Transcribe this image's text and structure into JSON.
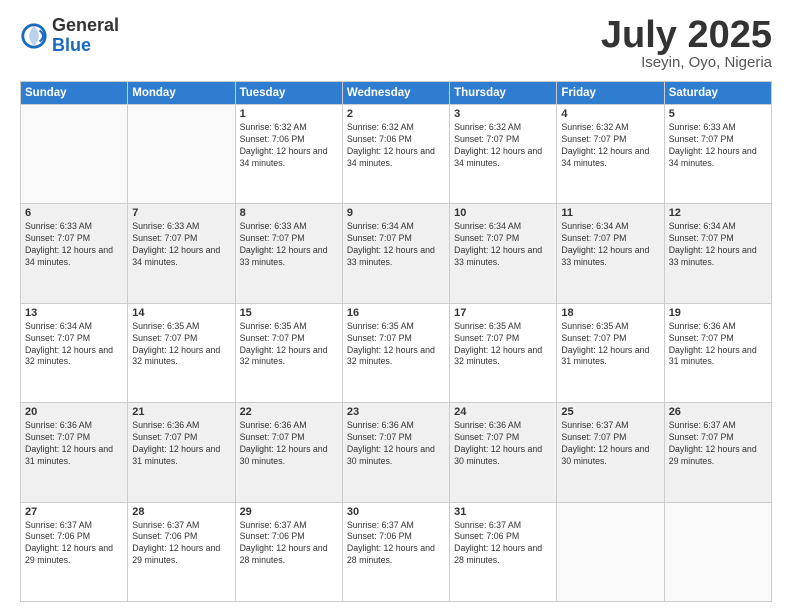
{
  "logo": {
    "general": "General",
    "blue": "Blue"
  },
  "title": "July 2025",
  "location": "Iseyin, Oyo, Nigeria",
  "days_of_week": [
    "Sunday",
    "Monday",
    "Tuesday",
    "Wednesday",
    "Thursday",
    "Friday",
    "Saturday"
  ],
  "weeks": [
    [
      {
        "day": "",
        "info": ""
      },
      {
        "day": "",
        "info": ""
      },
      {
        "day": "1",
        "sunrise": "Sunrise: 6:32 AM",
        "sunset": "Sunset: 7:06 PM",
        "daylight": "Daylight: 12 hours and 34 minutes."
      },
      {
        "day": "2",
        "sunrise": "Sunrise: 6:32 AM",
        "sunset": "Sunset: 7:06 PM",
        "daylight": "Daylight: 12 hours and 34 minutes."
      },
      {
        "day": "3",
        "sunrise": "Sunrise: 6:32 AM",
        "sunset": "Sunset: 7:07 PM",
        "daylight": "Daylight: 12 hours and 34 minutes."
      },
      {
        "day": "4",
        "sunrise": "Sunrise: 6:32 AM",
        "sunset": "Sunset: 7:07 PM",
        "daylight": "Daylight: 12 hours and 34 minutes."
      },
      {
        "day": "5",
        "sunrise": "Sunrise: 6:33 AM",
        "sunset": "Sunset: 7:07 PM",
        "daylight": "Daylight: 12 hours and 34 minutes."
      }
    ],
    [
      {
        "day": "6",
        "sunrise": "Sunrise: 6:33 AM",
        "sunset": "Sunset: 7:07 PM",
        "daylight": "Daylight: 12 hours and 34 minutes."
      },
      {
        "day": "7",
        "sunrise": "Sunrise: 6:33 AM",
        "sunset": "Sunset: 7:07 PM",
        "daylight": "Daylight: 12 hours and 34 minutes."
      },
      {
        "day": "8",
        "sunrise": "Sunrise: 6:33 AM",
        "sunset": "Sunset: 7:07 PM",
        "daylight": "Daylight: 12 hours and 33 minutes."
      },
      {
        "day": "9",
        "sunrise": "Sunrise: 6:34 AM",
        "sunset": "Sunset: 7:07 PM",
        "daylight": "Daylight: 12 hours and 33 minutes."
      },
      {
        "day": "10",
        "sunrise": "Sunrise: 6:34 AM",
        "sunset": "Sunset: 7:07 PM",
        "daylight": "Daylight: 12 hours and 33 minutes."
      },
      {
        "day": "11",
        "sunrise": "Sunrise: 6:34 AM",
        "sunset": "Sunset: 7:07 PM",
        "daylight": "Daylight: 12 hours and 33 minutes."
      },
      {
        "day": "12",
        "sunrise": "Sunrise: 6:34 AM",
        "sunset": "Sunset: 7:07 PM",
        "daylight": "Daylight: 12 hours and 33 minutes."
      }
    ],
    [
      {
        "day": "13",
        "sunrise": "Sunrise: 6:34 AM",
        "sunset": "Sunset: 7:07 PM",
        "daylight": "Daylight: 12 hours and 32 minutes."
      },
      {
        "day": "14",
        "sunrise": "Sunrise: 6:35 AM",
        "sunset": "Sunset: 7:07 PM",
        "daylight": "Daylight: 12 hours and 32 minutes."
      },
      {
        "day": "15",
        "sunrise": "Sunrise: 6:35 AM",
        "sunset": "Sunset: 7:07 PM",
        "daylight": "Daylight: 12 hours and 32 minutes."
      },
      {
        "day": "16",
        "sunrise": "Sunrise: 6:35 AM",
        "sunset": "Sunset: 7:07 PM",
        "daylight": "Daylight: 12 hours and 32 minutes."
      },
      {
        "day": "17",
        "sunrise": "Sunrise: 6:35 AM",
        "sunset": "Sunset: 7:07 PM",
        "daylight": "Daylight: 12 hours and 32 minutes."
      },
      {
        "day": "18",
        "sunrise": "Sunrise: 6:35 AM",
        "sunset": "Sunset: 7:07 PM",
        "daylight": "Daylight: 12 hours and 31 minutes."
      },
      {
        "day": "19",
        "sunrise": "Sunrise: 6:36 AM",
        "sunset": "Sunset: 7:07 PM",
        "daylight": "Daylight: 12 hours and 31 minutes."
      }
    ],
    [
      {
        "day": "20",
        "sunrise": "Sunrise: 6:36 AM",
        "sunset": "Sunset: 7:07 PM",
        "daylight": "Daylight: 12 hours and 31 minutes."
      },
      {
        "day": "21",
        "sunrise": "Sunrise: 6:36 AM",
        "sunset": "Sunset: 7:07 PM",
        "daylight": "Daylight: 12 hours and 31 minutes."
      },
      {
        "day": "22",
        "sunrise": "Sunrise: 6:36 AM",
        "sunset": "Sunset: 7:07 PM",
        "daylight": "Daylight: 12 hours and 30 minutes."
      },
      {
        "day": "23",
        "sunrise": "Sunrise: 6:36 AM",
        "sunset": "Sunset: 7:07 PM",
        "daylight": "Daylight: 12 hours and 30 minutes."
      },
      {
        "day": "24",
        "sunrise": "Sunrise: 6:36 AM",
        "sunset": "Sunset: 7:07 PM",
        "daylight": "Daylight: 12 hours and 30 minutes."
      },
      {
        "day": "25",
        "sunrise": "Sunrise: 6:37 AM",
        "sunset": "Sunset: 7:07 PM",
        "daylight": "Daylight: 12 hours and 30 minutes."
      },
      {
        "day": "26",
        "sunrise": "Sunrise: 6:37 AM",
        "sunset": "Sunset: 7:07 PM",
        "daylight": "Daylight: 12 hours and 29 minutes."
      }
    ],
    [
      {
        "day": "27",
        "sunrise": "Sunrise: 6:37 AM",
        "sunset": "Sunset: 7:06 PM",
        "daylight": "Daylight: 12 hours and 29 minutes."
      },
      {
        "day": "28",
        "sunrise": "Sunrise: 6:37 AM",
        "sunset": "Sunset: 7:06 PM",
        "daylight": "Daylight: 12 hours and 29 minutes."
      },
      {
        "day": "29",
        "sunrise": "Sunrise: 6:37 AM",
        "sunset": "Sunset: 7:06 PM",
        "daylight": "Daylight: 12 hours and 28 minutes."
      },
      {
        "day": "30",
        "sunrise": "Sunrise: 6:37 AM",
        "sunset": "Sunset: 7:06 PM",
        "daylight": "Daylight: 12 hours and 28 minutes."
      },
      {
        "day": "31",
        "sunrise": "Sunrise: 6:37 AM",
        "sunset": "Sunset: 7:06 PM",
        "daylight": "Daylight: 12 hours and 28 minutes."
      },
      {
        "day": "",
        "info": ""
      },
      {
        "day": "",
        "info": ""
      }
    ]
  ]
}
